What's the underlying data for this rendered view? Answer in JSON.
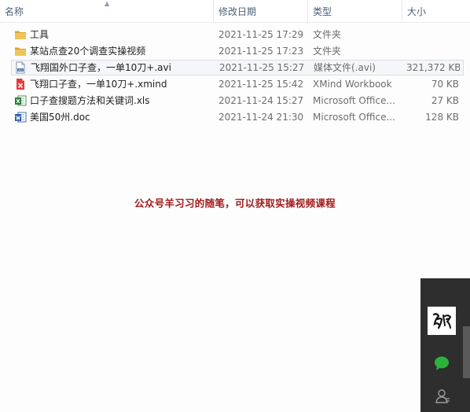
{
  "columns": {
    "name": "名称",
    "date": "修改日期",
    "type": "类型",
    "size": "大小"
  },
  "files": [
    {
      "icon": "folder-icon",
      "name": "工具",
      "date": "2021-11-25 17:29",
      "type": "文件夹",
      "size": ""
    },
    {
      "icon": "folder-icon",
      "name": "某站点查20个调查实操视频",
      "date": "2021-11-25 17:23",
      "type": "文件夹",
      "size": ""
    },
    {
      "icon": "avi-file-icon",
      "name": "飞翔国外口子查，一单10刀+.avi",
      "date": "2021-11-25 15:27",
      "type": "媒体文件(.avi)",
      "size": "321,372 KB",
      "selected": true
    },
    {
      "icon": "xmind-file-icon",
      "name": "飞翔口子查，一单10刀+.xmind",
      "date": "2021-11-25 15:42",
      "type": "XMind Workbook",
      "size": "70 KB"
    },
    {
      "icon": "excel-file-icon",
      "name": "口子查搜题方法和关键词.xls",
      "date": "2021-11-24 15:27",
      "type": "Microsoft Office...",
      "size": "27 KB"
    },
    {
      "icon": "word-file-icon",
      "name": "美国50州.doc",
      "date": "2021-11-24 21:30",
      "type": "Microsoft Office...",
      "size": "128 KB"
    }
  ],
  "watermark": "公众号羊习习的随笔，可以获取实操视频课程",
  "colors": {
    "folder": "#e8b645",
    "watermark": "#a31a1a",
    "header_text": "#4c607a",
    "side_panel": "#2e2e2e",
    "wechat": "#2bb43a"
  }
}
